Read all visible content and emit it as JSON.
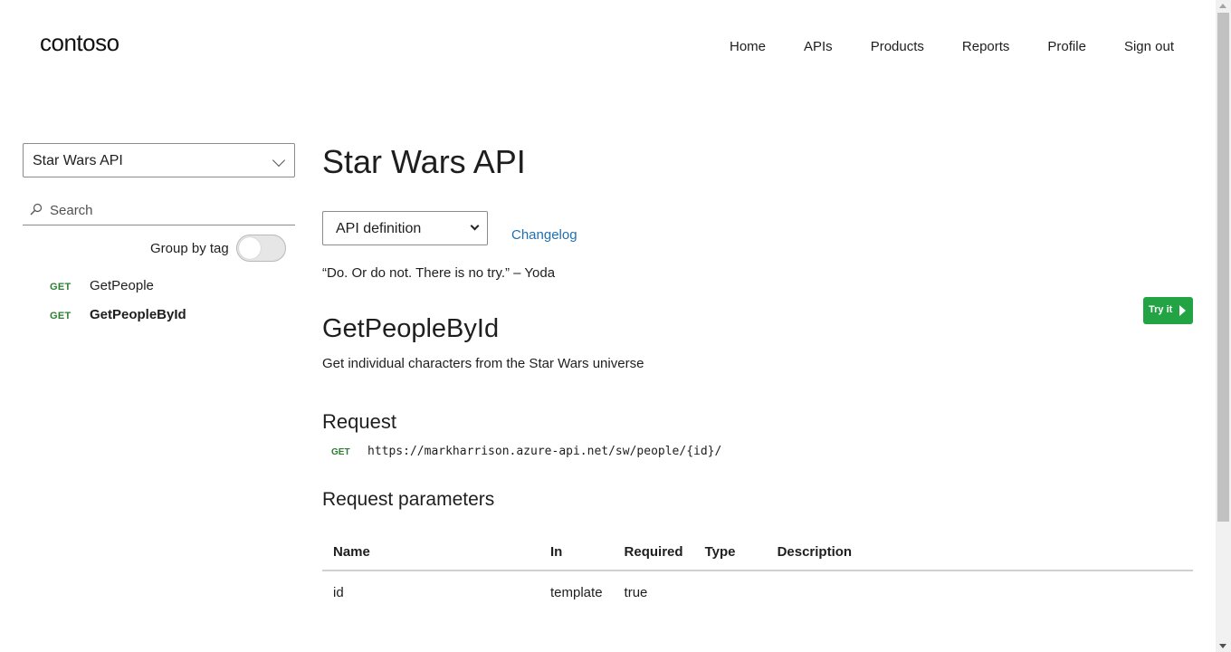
{
  "brand": {
    "logo": "contoso"
  },
  "nav": [
    "Home",
    "APIs",
    "Products",
    "Reports",
    "Profile",
    "Sign out"
  ],
  "sidebar": {
    "api_selected": "Star Wars API",
    "search_placeholder": "Search",
    "group_by_tag_label": "Group by tag",
    "group_by_tag_on": false,
    "operations": [
      {
        "method": "GET",
        "name": "GetPeople",
        "active": false
      },
      {
        "method": "GET",
        "name": "GetPeopleById",
        "active": true
      }
    ]
  },
  "main": {
    "title": "Star Wars API",
    "definition_selected": "API definition",
    "changelog_label": "Changelog",
    "quote": "“Do. Or do not. There is no try.” – Yoda",
    "try_it_label": "Try it",
    "operation": {
      "name": "GetPeopleById",
      "description": "Get individual characters from the Star Wars universe"
    },
    "request": {
      "heading": "Request",
      "method": "GET",
      "url": "https://markharrison.azure-api.net/sw/people/{id}/"
    },
    "params": {
      "heading": "Request parameters",
      "columns": [
        "Name",
        "In",
        "Required",
        "Type",
        "Description"
      ],
      "rows": [
        [
          "id",
          "template",
          "true",
          "",
          ""
        ]
      ]
    }
  },
  "colors": {
    "get_method": "#2e7d32",
    "try_button": "#22a444",
    "link": "#1f6fb2"
  }
}
